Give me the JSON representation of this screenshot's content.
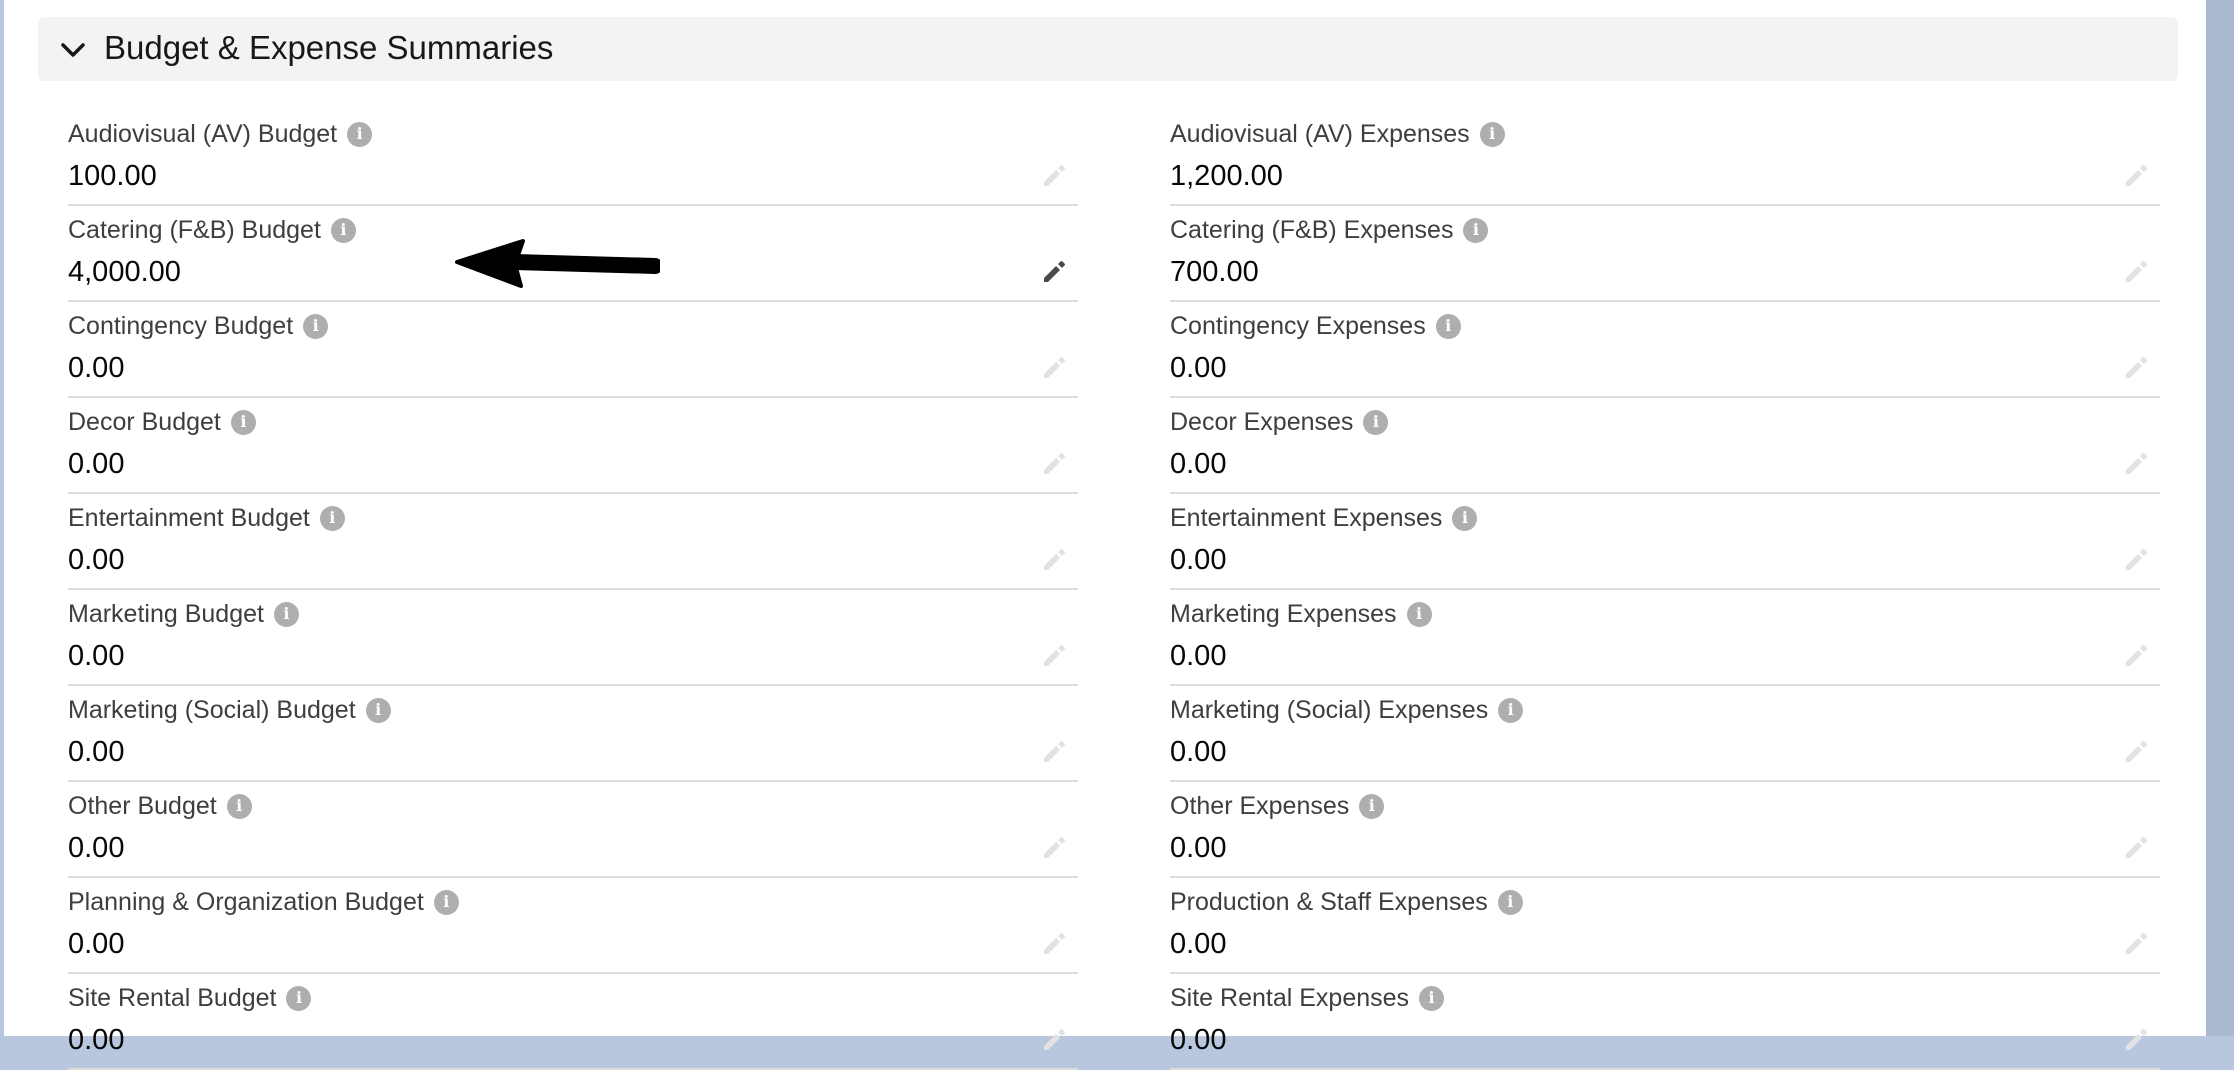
{
  "section": {
    "title": "Budget & Expense Summaries"
  },
  "left_fields": [
    {
      "label": "Audiovisual (AV) Budget",
      "value": "100.00"
    },
    {
      "label": "Catering (F&B) Budget",
      "value": "4,000.00"
    },
    {
      "label": "Contingency Budget",
      "value": "0.00"
    },
    {
      "label": "Decor Budget",
      "value": "0.00"
    },
    {
      "label": "Entertainment Budget",
      "value": "0.00"
    },
    {
      "label": "Marketing Budget",
      "value": "0.00"
    },
    {
      "label": "Marketing (Social) Budget",
      "value": "0.00"
    },
    {
      "label": "Other Budget",
      "value": "0.00"
    },
    {
      "label": "Planning & Organization Budget",
      "value": "0.00"
    },
    {
      "label": "Site Rental Budget",
      "value": "0.00"
    }
  ],
  "right_fields": [
    {
      "label": "Audiovisual (AV) Expenses",
      "value": "1,200.00"
    },
    {
      "label": "Catering (F&B) Expenses",
      "value": "700.00"
    },
    {
      "label": "Contingency Expenses",
      "value": "0.00"
    },
    {
      "label": "Decor Expenses",
      "value": "0.00"
    },
    {
      "label": "Entertainment Expenses",
      "value": "0.00"
    },
    {
      "label": "Marketing Expenses",
      "value": "0.00"
    },
    {
      "label": "Marketing (Social) Expenses",
      "value": "0.00"
    },
    {
      "label": "Other Expenses",
      "value": "0.00"
    },
    {
      "label": "Production & Staff Expenses",
      "value": "0.00"
    },
    {
      "label": "Site Rental Expenses",
      "value": "0.00"
    }
  ],
  "icons": {
    "info": "info-icon",
    "edit": "pencil-icon",
    "collapse": "chevron-down-icon",
    "annotation": "arrow-left-icon"
  },
  "colors": {
    "header_bg": "#f3f3f3",
    "divider": "#dddbda",
    "info_icon": "#aeaeae",
    "pencil_active": "#4a4a4a",
    "pencil_inactive": "#e2e2e2"
  }
}
